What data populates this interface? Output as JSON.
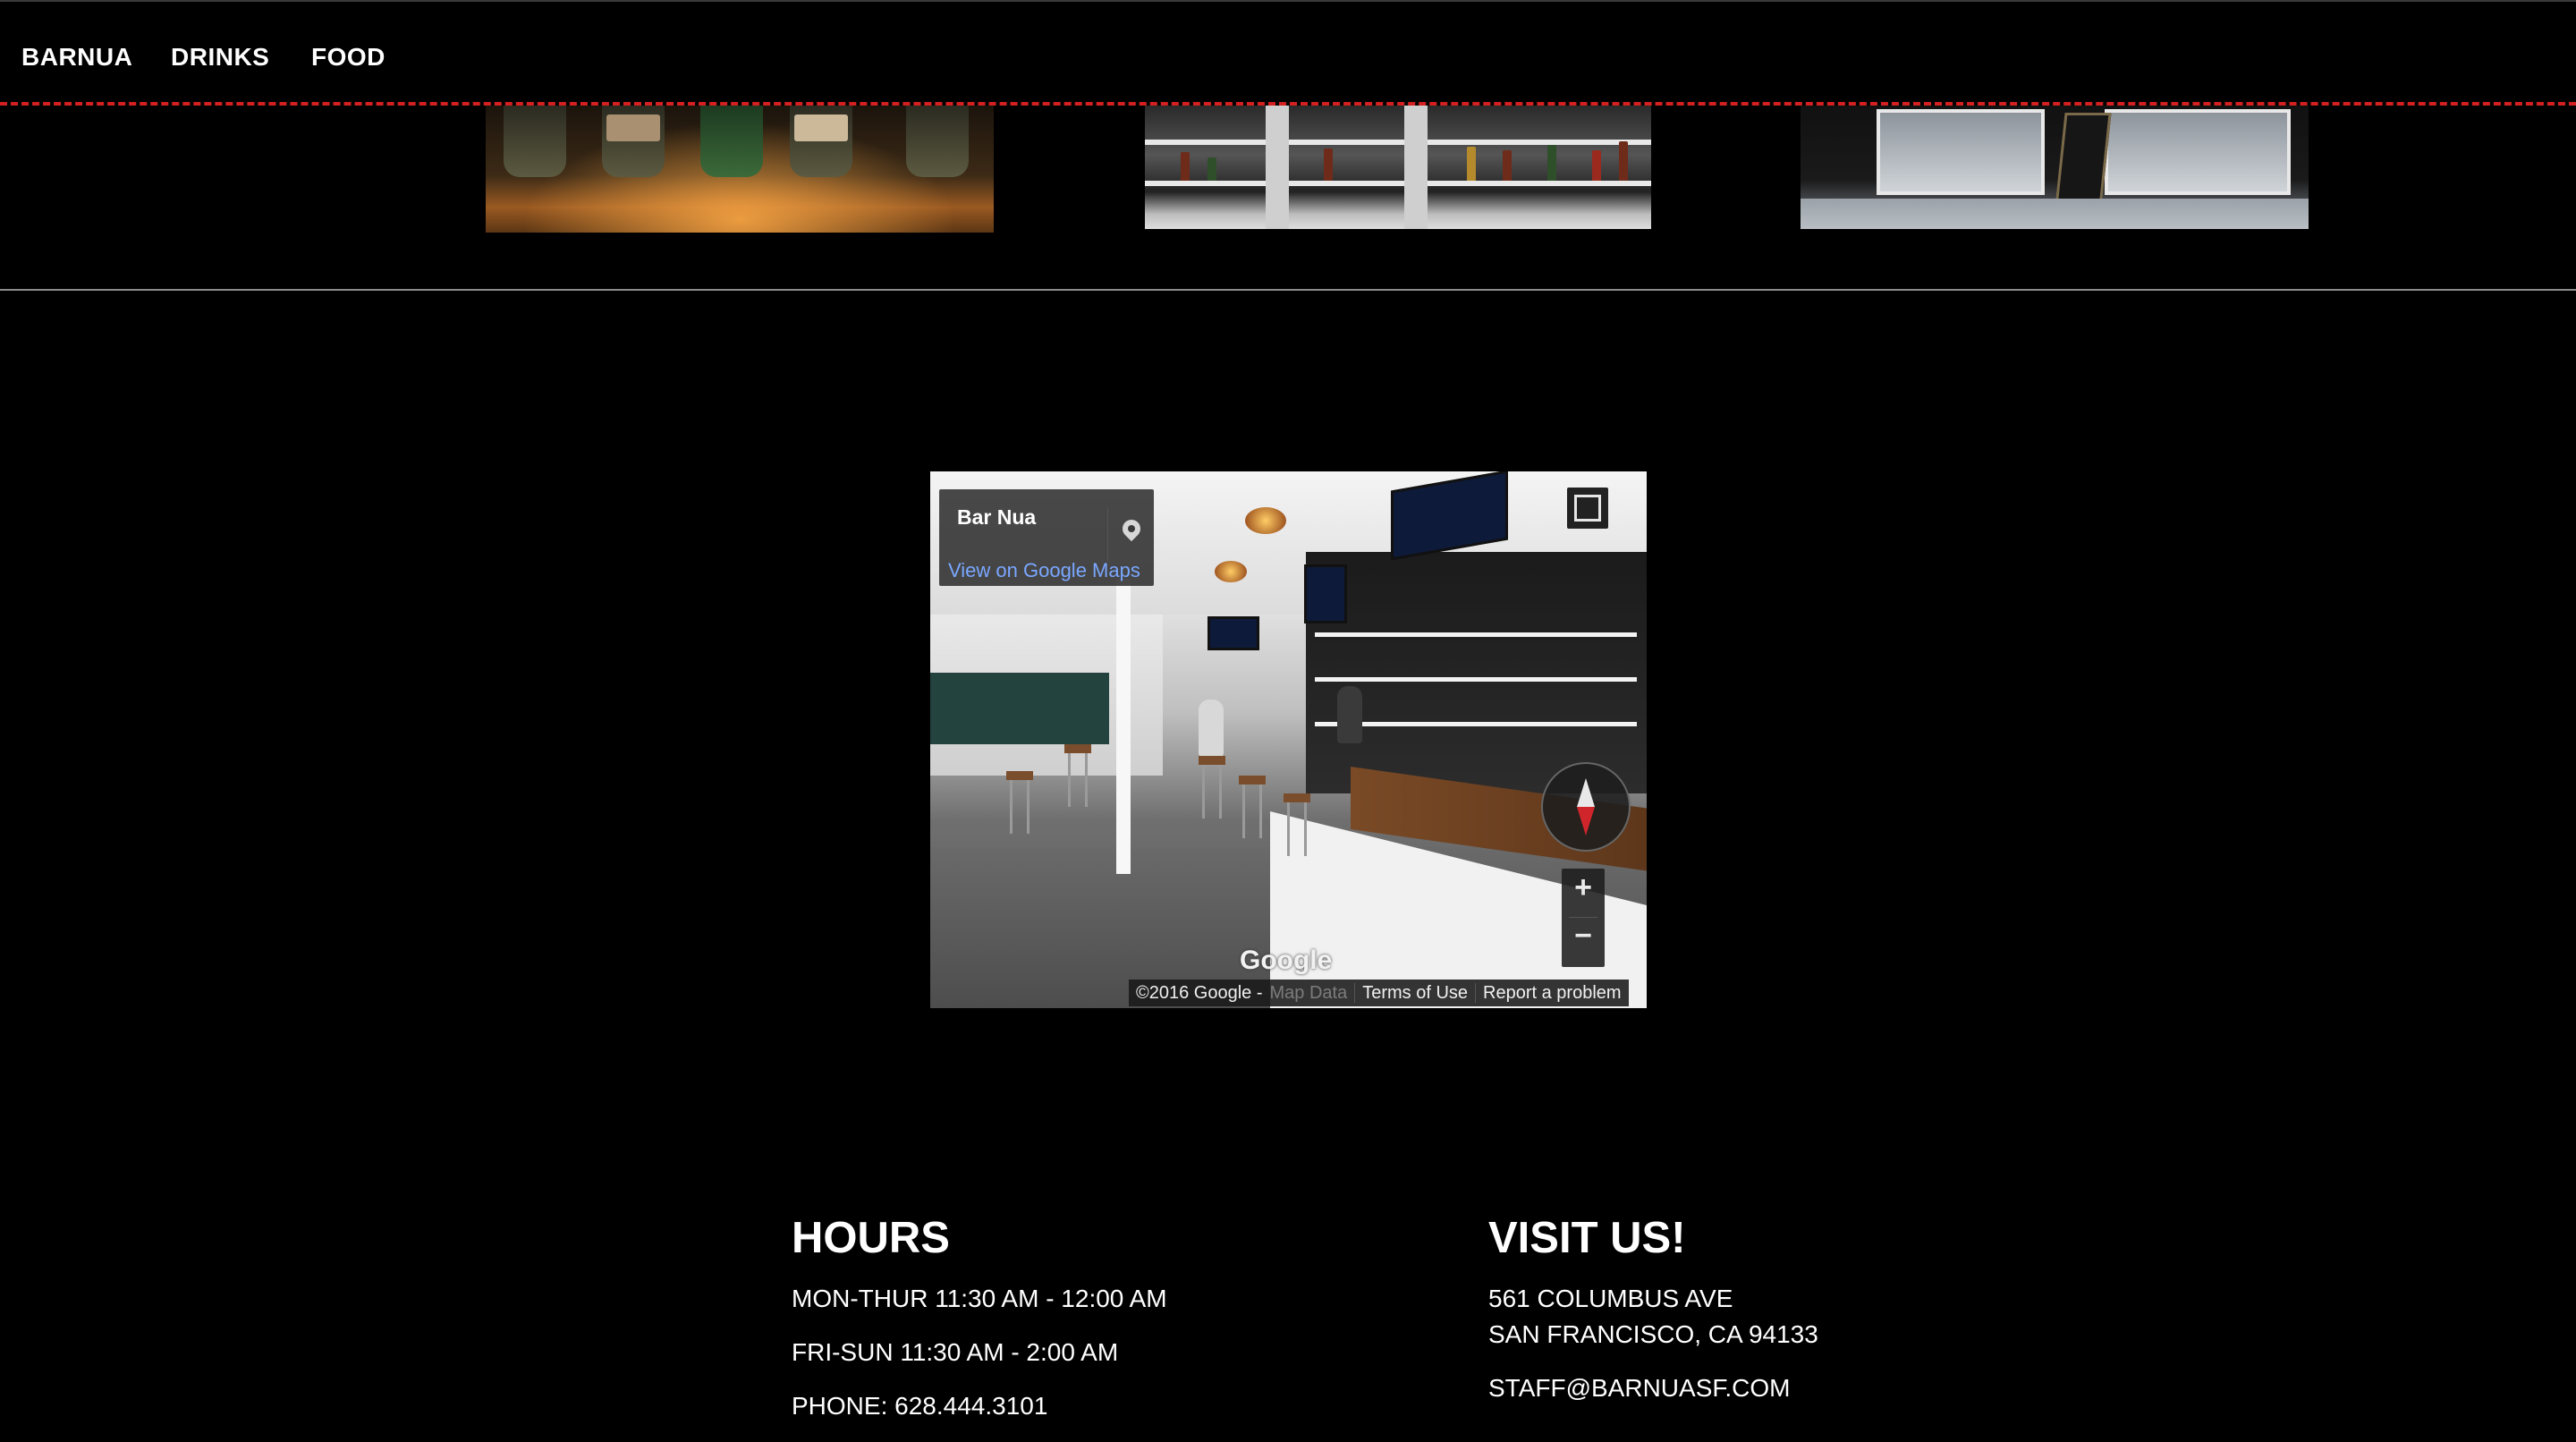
{
  "nav": {
    "items": [
      {
        "label": "BARNUA"
      },
      {
        "label": "DRINKS"
      },
      {
        "label": "FOOD"
      }
    ]
  },
  "colors": {
    "background": "#000000",
    "accent_dashed_line": "#d42020",
    "link": "#7aa7ff"
  },
  "gallery": {
    "images": [
      {
        "icon": "bar-counter-bottles-photo"
      },
      {
        "icon": "bar-shelves-photo"
      },
      {
        "icon": "storefront-photo"
      }
    ]
  },
  "map": {
    "place_name": "Bar Nua",
    "view_link": "View on Google Maps",
    "logo_text": "Google",
    "copyright": "©2016 Google -",
    "map_data": "Map Data",
    "terms": "Terms of Use",
    "report": "Report a problem",
    "zoom_in": "+",
    "zoom_out": "−",
    "icons": [
      "pin-icon",
      "fullscreen-icon",
      "compass-icon"
    ]
  },
  "hours": {
    "title": "HOURS",
    "lines": [
      "MON-THUR 11:30 AM - 12:00 AM",
      "FRI-SUN 11:30 AM - 2:00 AM",
      "PHONE: 628.444.3101"
    ]
  },
  "visit": {
    "title": "VISIT US!",
    "address_line1": "561 COLUMBUS AVE",
    "address_line2": "SAN FRANCISCO, CA 94133",
    "email": "STAFF@BARNUASF.COM"
  }
}
